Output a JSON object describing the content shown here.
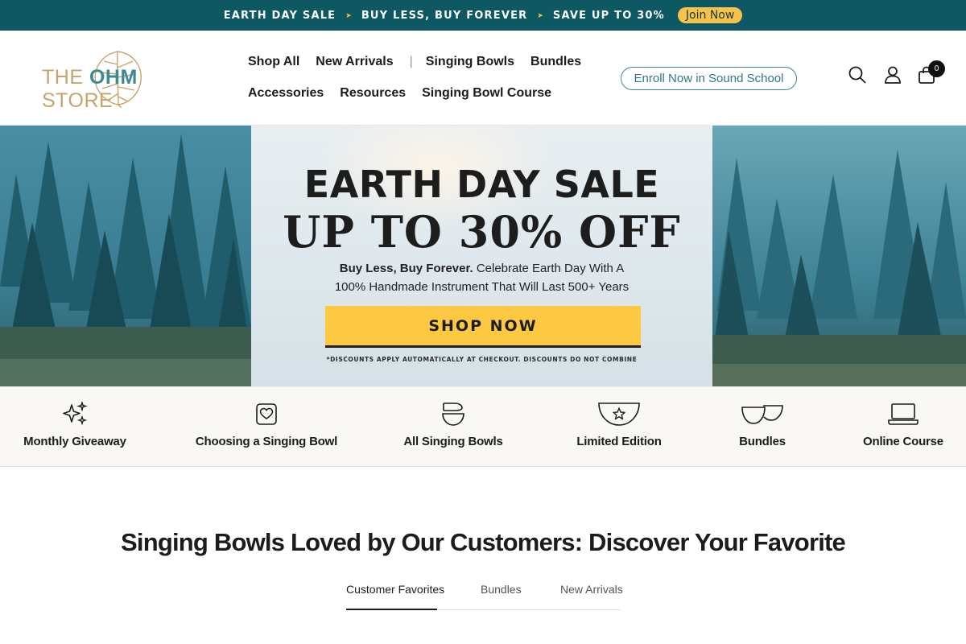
{
  "announcement": {
    "items": [
      "EARTH DAY SALE",
      "BUY LESS, BUY FOREVER",
      "SAVE UP TO 30%"
    ],
    "separator": "➤",
    "join_label": "Join Now"
  },
  "header": {
    "logo": {
      "text_left": "THE ",
      "text_brand": "OHM",
      "text_right": " STORE"
    },
    "nav_row1": [
      "Shop All",
      "New Arrivals",
      "Singing Bowls",
      "Bundles"
    ],
    "nav_divider": "|",
    "nav_row2": [
      "Accessories",
      "Resources",
      "Singing Bowl Course"
    ],
    "enroll_label": "Enroll Now in Sound School",
    "icons": [
      "search-icon",
      "account-icon",
      "cart-icon"
    ],
    "cart_count": "0"
  },
  "hero": {
    "title_line1": "EARTH DAY SALE",
    "title_line2": "UP TO 30% OFF",
    "subtitle_bold": "Buy Less, Buy Forever.",
    "subtitle_rest": " Celebrate Earth Day With A",
    "subtitle_line2": "100% Handmade Instrument That Will Last 500+ Years",
    "button_label": "SHOP NOW",
    "disclaimer": "*DISCOUNTS APPLY AUTOMATICALLY AT CHECKOUT. DISCOUNTS DO NOT COMBINE"
  },
  "categories": [
    {
      "label": "Monthly Giveaway",
      "icon": "sparkles-icon"
    },
    {
      "label": "Choosing a Singing Bowl",
      "icon": "heart-box-icon"
    },
    {
      "label": "All Singing Bowls",
      "icon": "bowl-stack-icon"
    },
    {
      "label": "Limited Edition",
      "icon": "star-bowl-icon"
    },
    {
      "label": "Bundles",
      "icon": "bundle-bowls-icon"
    },
    {
      "label": "Online Course",
      "icon": "laptop-icon"
    }
  ],
  "section": {
    "title": "Singing Bowls Loved by Our Customers: Discover Your Favorite",
    "tabs": [
      "Customer Favorites",
      "Bundles",
      "New Arrivals"
    ],
    "active_tab": "Customer Favorites"
  },
  "colors": {
    "announce_bg": "#0e5863",
    "accent_yellow": "#fdc842",
    "brand_teal": "#3d8a93",
    "brand_gold": "#c6a46a"
  }
}
